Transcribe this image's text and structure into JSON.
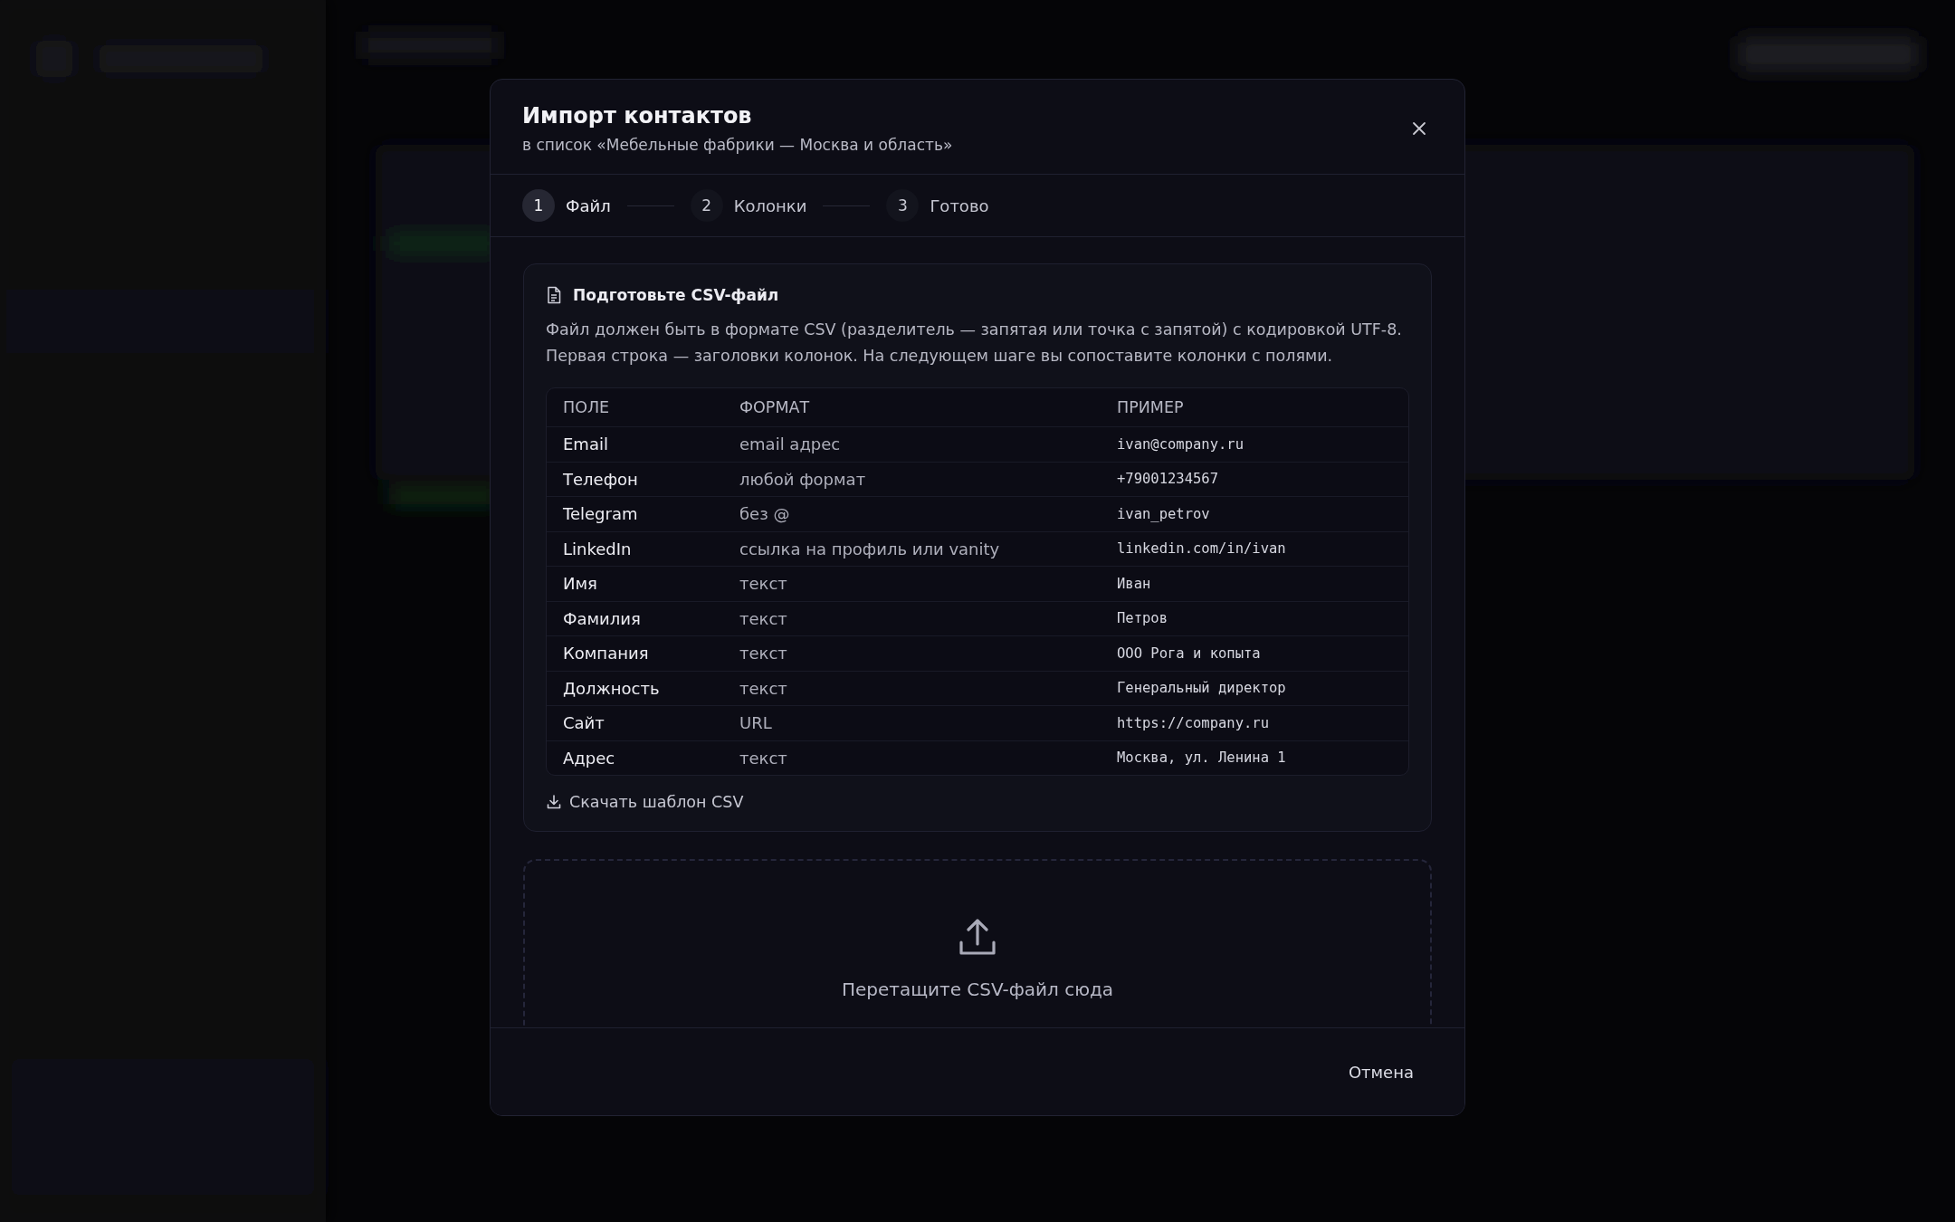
{
  "dialog": {
    "title": "Импорт контактов",
    "subtitle": "в список «Мебельные фабрики — Москва и область»",
    "steps": [
      {
        "number": "1",
        "label": "Файл",
        "selected": true
      },
      {
        "number": "2",
        "label": "Колонки",
        "selected": false
      },
      {
        "number": "3",
        "label": "Готово",
        "selected": false
      }
    ],
    "info_card": {
      "title": "Подготовьте CSV-файл",
      "description": "Файл должен быть в формате CSV (разделитель — запятая или точка с запятой) с кодировкой UTF-8. Первая строка — заголовки колонок. На следующем шаге вы сопоставите колонки с полями.",
      "table": {
        "columns": [
          "ПОЛЕ",
          "ФОРМАТ",
          "ПРИМЕР"
        ],
        "rows": [
          [
            "Email",
            "email адрес",
            "ivan@company.ru"
          ],
          [
            "Телефон",
            "любой формат",
            "+79001234567"
          ],
          [
            "Telegram",
            "без @",
            "ivan_petrov"
          ],
          [
            "LinkedIn",
            "ссылка на профиль или vanity",
            "linkedin.com/in/ivan"
          ],
          [
            "Имя",
            "текст",
            "Иван"
          ],
          [
            "Фамилия",
            "текст",
            "Петров"
          ],
          [
            "Компания",
            "текст",
            "ООО Рога и копыта"
          ],
          [
            "Должность",
            "текст",
            "Генеральный директор"
          ],
          [
            "Сайт",
            "URL",
            "https://company.ru"
          ],
          [
            "Адрес",
            "текст",
            "Москва, ул. Ленина 1"
          ]
        ]
      },
      "download_link": "Скачать шаблон CSV"
    },
    "dropzone": {
      "text": "Перетащите CSV-файл сюда"
    },
    "buttons": [
      "Отмена"
    ]
  }
}
